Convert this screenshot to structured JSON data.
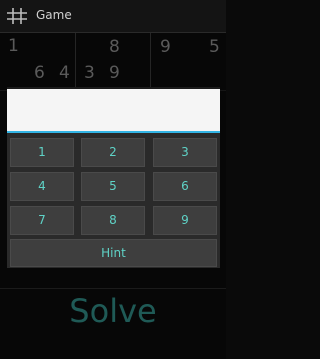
{
  "action_bar": {
    "title": "Game",
    "icon": "grid-icon"
  },
  "board": {
    "visible_digits": [
      {
        "value": "1"
      },
      {
        "value": "8"
      },
      {
        "value": "9"
      },
      {
        "value": "5"
      },
      {
        "value": "6"
      },
      {
        "value": "4"
      },
      {
        "value": "3"
      },
      {
        "value": "9"
      }
    ]
  },
  "dialog": {
    "input_value": "",
    "keys": [
      "1",
      "2",
      "3",
      "4",
      "5",
      "6",
      "7",
      "8",
      "9"
    ],
    "hint_label": "Hint"
  },
  "solve_label": "Solve",
  "colors": {
    "accent": "#33b5e5",
    "key_text": "#5fd3c7",
    "solve_text": "#1f5a56"
  }
}
